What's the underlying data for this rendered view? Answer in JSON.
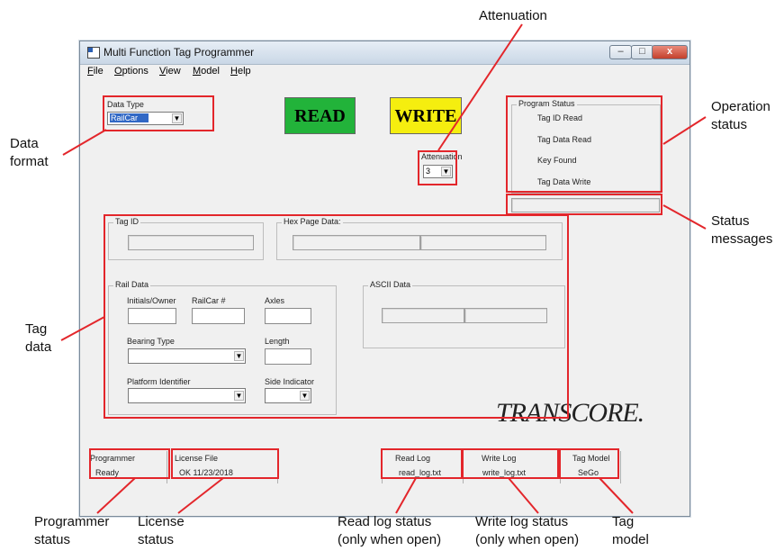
{
  "window": {
    "title": "Multi Function Tag Programmer"
  },
  "menu": [
    "File",
    "Options",
    "View",
    "Model",
    "Help"
  ],
  "data_type": {
    "label": "Data Type",
    "value": "RailCar"
  },
  "buttons": {
    "read": "READ",
    "write": "WRITE"
  },
  "attenuation": {
    "label": "Attenuation",
    "value": "3"
  },
  "program_status": {
    "title": "Program Status",
    "items": [
      "Tag ID Read",
      "Tag Data Read",
      "Key Found",
      "Tag Data Write"
    ]
  },
  "tag_id": {
    "label": "Tag ID"
  },
  "hex_page": {
    "label": "Hex Page Data:"
  },
  "rail_data": {
    "label": "Rail Data",
    "initials_owner": "Initials/Owner",
    "railcar_num": "RailCar #",
    "axles": "Axles",
    "bearing_type": "Bearing Type",
    "length": "Length",
    "platform_identifier": "Platform Identifier",
    "side_indicator": "Side Indicator"
  },
  "ascii": {
    "label": "ASCII Data"
  },
  "logo": "TRANSCORE.",
  "status_bar": {
    "programmer_label": "Programmer",
    "programmer_value": "Ready",
    "license_label": "License File",
    "license_value": "OK 11/23/2018",
    "readlog_label": "Read Log",
    "readlog_value": "read_log.txt",
    "writelog_label": "Write Log",
    "writelog_value": "write_log.txt",
    "tagmodel_label": "Tag Model",
    "tagmodel_value": "SeGo"
  },
  "callouts": {
    "attenuation": "Attenuation",
    "data_format": "Data\nformat",
    "operation_status": "Operation\nstatus",
    "status_messages": "Status\nmessages",
    "tag_data": "Tag\ndata",
    "programmer_status": "Programmer\nstatus",
    "license_status": "License\nstatus",
    "read_log_status": "Read log status\n(only when open)",
    "write_log_status": "Write log status\n(only when open)",
    "tag_model": "Tag\nmodel"
  },
  "colors": {
    "read_button": "#22b33a",
    "write_button": "#f5ee0f",
    "callout_box": "#e3262b"
  }
}
